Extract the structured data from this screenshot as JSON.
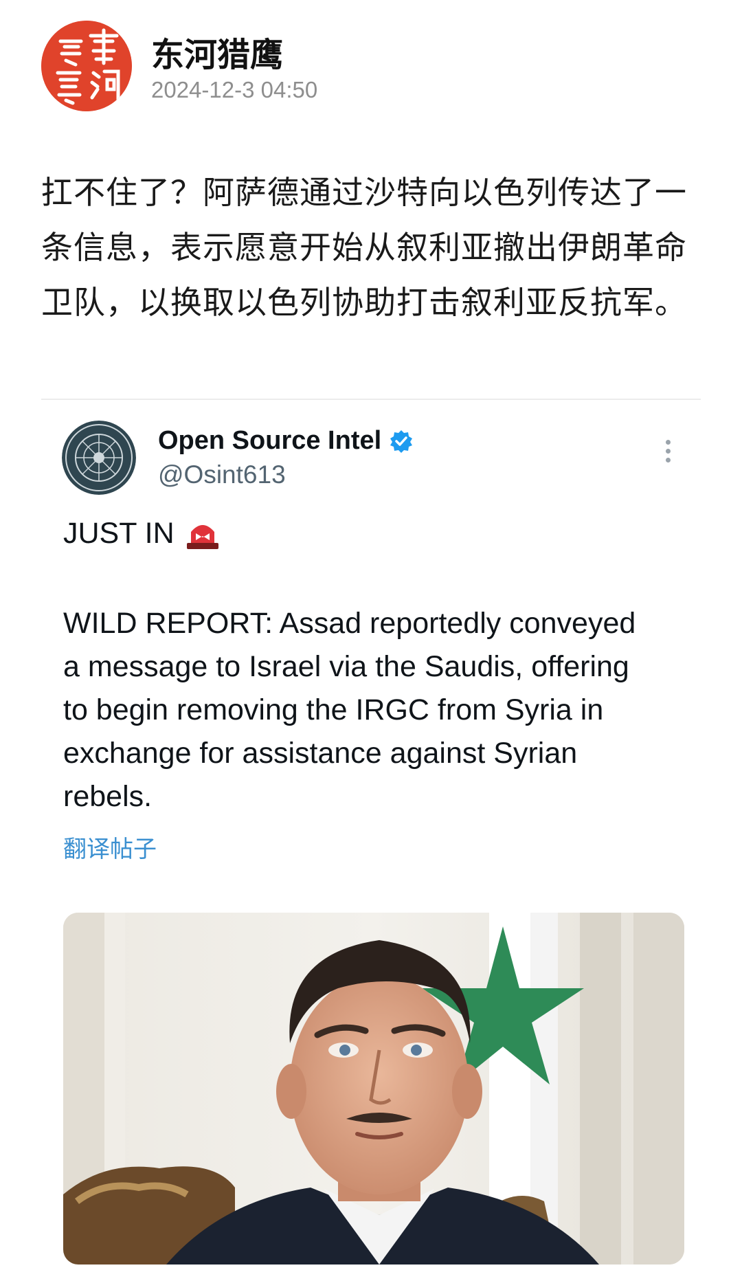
{
  "post": {
    "author_name": "东河猎鹰",
    "timestamp": "2024-12-3 04:50",
    "text": "扛不住了？阿萨德通过沙特向以色列传达了一条信息，表示愿意开始从叙利亚撤出伊朗革命卫队，以换取以色列协助打击叙利亚反抗军。",
    "avatar_seal_text": "東河獵鷹"
  },
  "tweet": {
    "display_name": "Open Source Intel",
    "handle": "@Osint613",
    "headline": "JUST IN",
    "body": "WILD REPORT: Assad reportedly conveyed a message to Israel via the Saudis, offering to begin removing the IRGC from Syria in exchange for assistance against Syrian rebels.",
    "translate_label": "翻译帖子"
  },
  "icons": {
    "verified": "verified-badge-icon",
    "more": "more-options-icon",
    "siren": "siren-emoji-icon"
  },
  "colors": {
    "seal_red": "#e0432b",
    "verified_blue": "#1d9bf0",
    "link_blue": "#3a8fd0",
    "muted_gray": "#8e8e8e"
  }
}
